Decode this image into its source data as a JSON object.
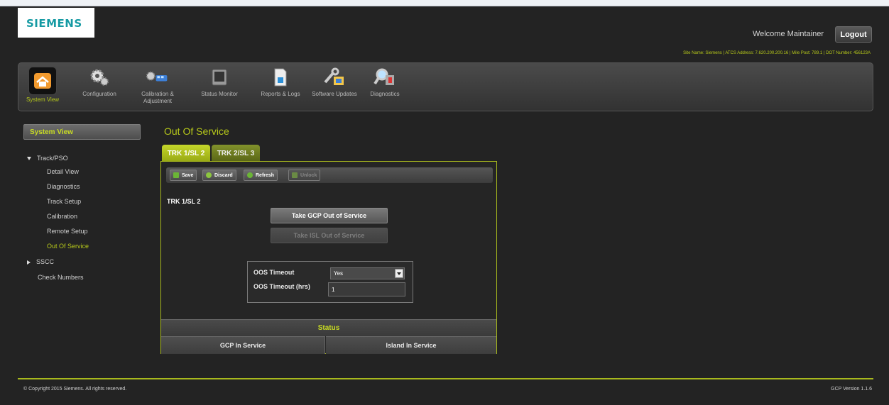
{
  "brand": {
    "logo_text": "SIEMENS"
  },
  "header": {
    "welcome": "Welcome Maintainer",
    "logout_label": "Logout",
    "site_info": "Site Name: Siemens | ATCS Address: 7.620.200.200.16 | Mile Post: 789.1 | DOT Number: 456123A"
  },
  "toolbar": {
    "items": [
      {
        "label": "System View",
        "icon": "house-icon"
      },
      {
        "label": "Configuration",
        "icon": "gears-icon"
      },
      {
        "label": "Calibration & Adjustment",
        "icon": "train-calibration-icon"
      },
      {
        "label": "Status Monitor",
        "icon": "monitor-icon"
      },
      {
        "label": "Reports & Logs",
        "icon": "report-icon"
      },
      {
        "label": "Software Updates",
        "icon": "software-update-icon"
      },
      {
        "label": "Diagnostics",
        "icon": "diagnostics-magnifier-icon"
      }
    ]
  },
  "sidebar": {
    "heading": "System View",
    "groups": [
      {
        "label": "Track/PSO",
        "items": [
          "Detail View",
          "Diagnostics",
          "Track Setup",
          "Calibration",
          "Remote Setup",
          "Out Of Service"
        ]
      },
      {
        "label": "SSCC",
        "items": []
      }
    ],
    "check_numbers": "Check Numbers"
  },
  "main": {
    "title": "Out Of Service",
    "tabs": [
      "TRK 1/SL 2",
      "TRK 2/SL 3"
    ],
    "actions": {
      "save": "Save",
      "discard": "Discard",
      "refresh": "Refresh",
      "unlock": "Unlock"
    },
    "track_label": "TRK 1/SL 2",
    "gcp_button": "Take GCP Out of Service",
    "isl_button": "Take ISL Out of Service",
    "oos_timeout_label": "OOS Timeout",
    "oos_timeout_value": "Yes",
    "oos_timeout_hrs_label": "OOS Timeout (hrs)",
    "oos_timeout_hrs_value": "1",
    "status": {
      "heading": "Status",
      "gcp": "GCP In Service",
      "island": "Island In Service"
    }
  },
  "footer": {
    "copyright": "© Copyright 2015 Siemens. All rights reserved.",
    "version": "GCP Version 1.1.6"
  },
  "colors": {
    "accent": "#b7c91a",
    "background": "#232323",
    "brand": "#159aa3"
  }
}
